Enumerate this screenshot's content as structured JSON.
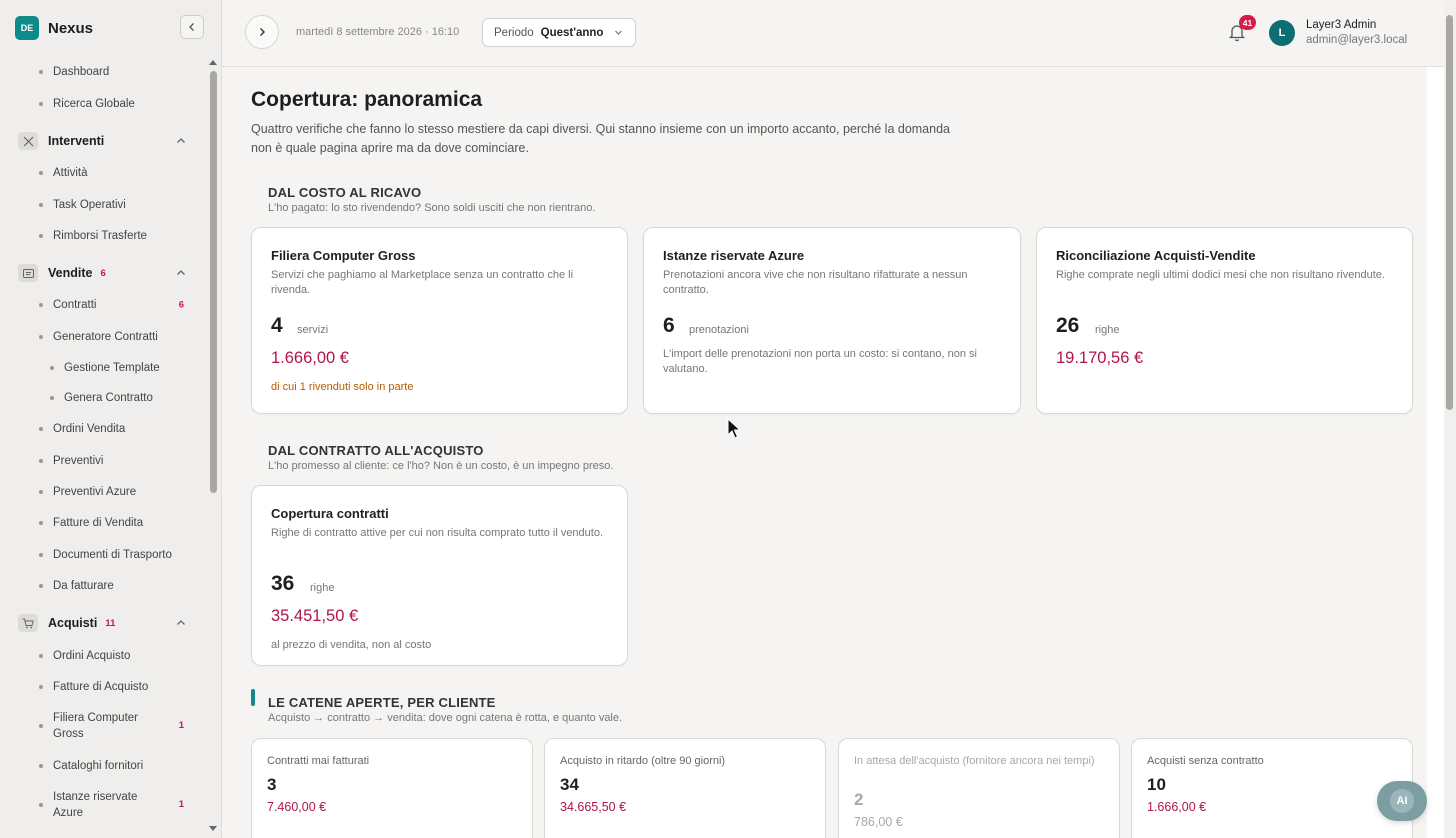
{
  "brand": {
    "logo": "DE",
    "name": "Nexus"
  },
  "sidebar": {
    "top_items": [
      {
        "label": "Dashboard"
      },
      {
        "label": "Ricerca Globale"
      }
    ],
    "groups": {
      "interventi": {
        "label": "Interventi",
        "items": [
          {
            "label": "Attività"
          },
          {
            "label": "Task Operativi"
          },
          {
            "label": "Rimborsi Trasferte"
          }
        ]
      },
      "vendite": {
        "label": "Vendite",
        "count": "6",
        "items": [
          {
            "label": "Contratti",
            "count": "6"
          },
          {
            "label": "Generatore Contratti"
          },
          {
            "label": "Gestione Template"
          },
          {
            "label": "Genera Contratto"
          },
          {
            "label": "Ordini Vendita"
          },
          {
            "label": "Preventivi"
          },
          {
            "label": "Preventivi Azure"
          },
          {
            "label": "Fatture di Vendita"
          },
          {
            "label": "Documenti di Trasporto"
          },
          {
            "label": "Da fatturare"
          }
        ]
      },
      "acquisti": {
        "label": "Acquisti",
        "count": "11",
        "items": [
          {
            "label": "Ordini Acquisto"
          },
          {
            "label": "Fatture di Acquisto"
          },
          {
            "label": "Filiera Computer Gross",
            "count": "1"
          },
          {
            "label": "Cataloghi fornitori"
          },
          {
            "label": "Istanze riservate Azure",
            "count": "1"
          }
        ]
      }
    }
  },
  "topbar": {
    "datetime": "martedì 8 settembre 2026 · 16:10",
    "period_label": "Periodo",
    "period_value": "Quest'anno",
    "notifications": "41",
    "user": {
      "initial": "L",
      "name": "Layer3 Admin",
      "email": "admin@layer3.local"
    }
  },
  "page": {
    "title": "Copertura: panoramica",
    "description": "Quattro verifiche che fanno lo stesso mestiere da capi diversi. Qui stanno insieme con un importo accanto, perché la domanda non è quale pagina aprire ma da dove cominciare."
  },
  "sections": {
    "costo_ricavo": {
      "title": "DAL COSTO AL RICAVO",
      "subtitle": "L'ho pagato: lo sto rivendendo? Sono soldi usciti che non rientrano.",
      "cards": [
        {
          "title": "Filiera Computer Gross",
          "desc": "Servizi che paghiamo al Marketplace senza un contratto che li rivenda.",
          "number": "4",
          "unit": "servizi",
          "amount": "1.666,00 €",
          "note": "di cui 1 rivenduti solo in parte"
        },
        {
          "title": "Istanze riservate Azure",
          "desc": "Prenotazioni ancora vive che non risultano rifatturate a nessun contratto.",
          "number": "6",
          "unit": "prenotazioni",
          "note": "L'import delle prenotazioni non porta un costo: si contano, non si valutano."
        },
        {
          "title": "Riconciliazione Acquisti-Vendite",
          "desc": "Righe comprate negli ultimi dodici mesi che non risultano rivendute.",
          "number": "26",
          "unit": "righe",
          "amount": "19.170,56 €"
        }
      ]
    },
    "contratto_acquisto": {
      "title": "DAL CONTRATTO ALL'ACQUISTO",
      "subtitle": "L'ho promesso al cliente: ce l'ho? Non è un costo, è un impegno preso.",
      "cards": [
        {
          "title": "Copertura contratti",
          "desc": "Righe di contratto attive per cui non risulta comprato tutto il venduto.",
          "number": "36",
          "unit": "righe",
          "amount": "35.451,50 €",
          "note": "al prezzo di vendita, non al costo"
        }
      ]
    },
    "catene": {
      "title": "LE CATENE APERTE, PER CLIENTE",
      "subtitle": "Acquisto → contratto → vendita: dove ogni catena è rotta, e quanto vale.",
      "cards": [
        {
          "label": "Contratti mai fatturati",
          "number": "3",
          "amount": "7.460,00 €"
        },
        {
          "label": "Acquisto in ritardo (oltre 90 giorni)",
          "number": "34",
          "amount": "34.665,50 €"
        },
        {
          "label": "In attesa dell'acquisto (fornitore ancora nei tempi)",
          "number": "2",
          "amount": "786,00 €"
        },
        {
          "label": "Acquisti senza contratto",
          "number": "10",
          "amount": "1.666,00 €"
        }
      ]
    }
  },
  "ai_button": "AI",
  "colors": {
    "accent": "#0d8a8a",
    "amount": "#b1134f",
    "badge": "#d81b4a",
    "warning": "#b85a00"
  }
}
